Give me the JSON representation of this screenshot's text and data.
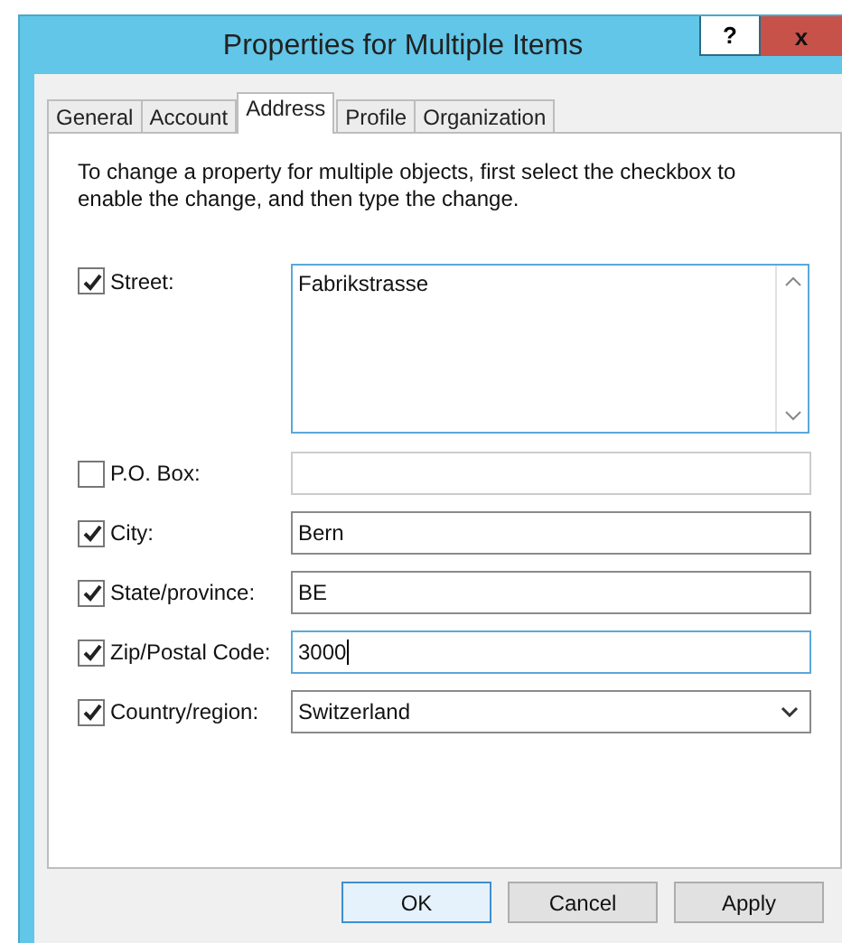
{
  "window": {
    "title": "Properties for Multiple Items",
    "help_button": "?",
    "close_button": "x"
  },
  "tabs": [
    {
      "label": "General",
      "selected": false
    },
    {
      "label": "Account",
      "selected": false
    },
    {
      "label": "Address",
      "selected": true
    },
    {
      "label": "Profile",
      "selected": false
    },
    {
      "label": "Organization",
      "selected": false
    }
  ],
  "instructions": "To change a property for multiple objects, first select the checkbox to enable the change, and then type the change.",
  "fields": [
    {
      "kind": "textarea",
      "label": "Street:",
      "checked": true,
      "value": "Fabrikstrasse",
      "focused": true
    },
    {
      "kind": "text",
      "label": "P.O. Box:",
      "checked": false,
      "focused": false
    },
    {
      "kind": "text",
      "label": "City:",
      "checked": true,
      "value": "Bern",
      "focused": false
    },
    {
      "kind": "text",
      "label": "State/province:",
      "checked": true,
      "value": "BE",
      "focused": false
    },
    {
      "kind": "text",
      "label": "Zip/Postal Code:",
      "checked": true,
      "value": "3000",
      "focused": true
    },
    {
      "kind": "dropdown",
      "label": "Country/region:",
      "checked": true,
      "value": "Switzerland",
      "focused": false
    }
  ],
  "buttons": [
    {
      "label": "OK",
      "default": true
    },
    {
      "label": "Cancel",
      "default": false
    },
    {
      "label": "Apply",
      "default": false
    }
  ]
}
